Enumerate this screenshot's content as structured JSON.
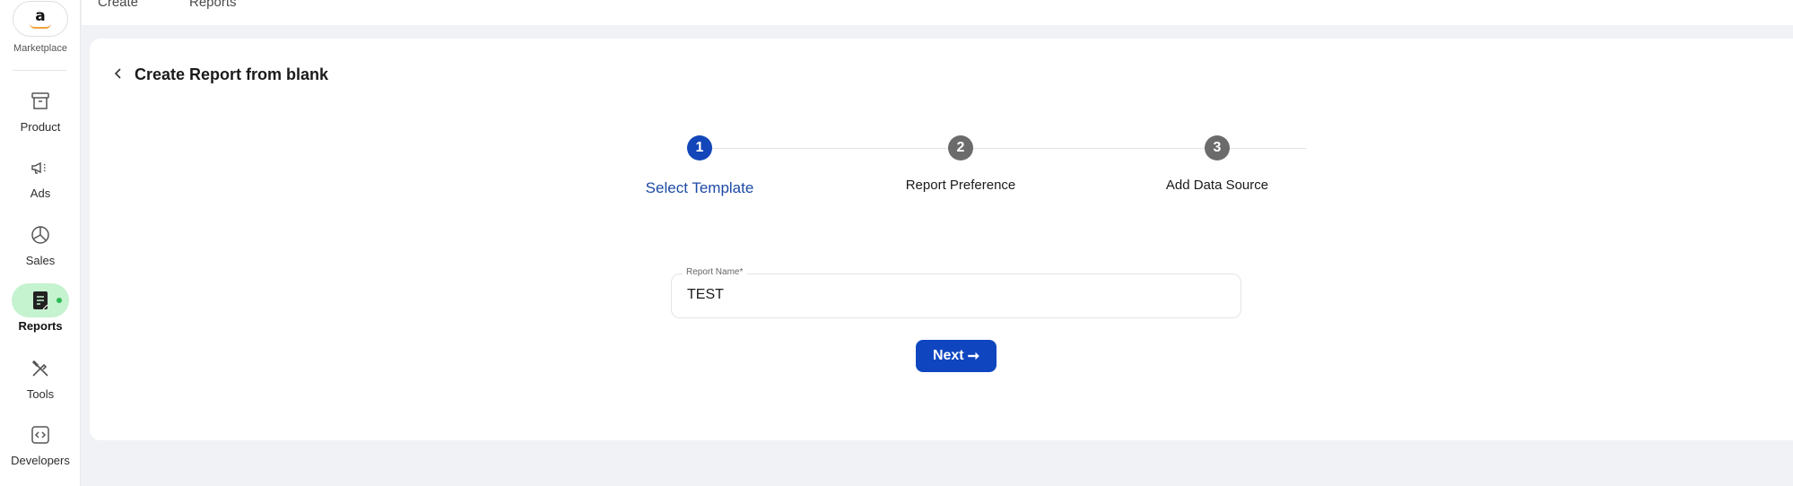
{
  "sidebar": {
    "logo_letter": "a",
    "logo_label": "Marketplace",
    "items": [
      {
        "label": "Product",
        "icon": "archive-box-icon",
        "active": false
      },
      {
        "label": "Ads",
        "icon": "megaphone-icon",
        "active": false
      },
      {
        "label": "Sales",
        "icon": "pie-chart-icon",
        "active": false
      },
      {
        "label": "Reports",
        "icon": "report-document-icon",
        "active": true
      },
      {
        "label": "Tools",
        "icon": "tools-icon",
        "active": false
      },
      {
        "label": "Developers",
        "icon": "code-icon",
        "active": false
      }
    ]
  },
  "topbar": {
    "tabs": [
      {
        "label": "Create"
      },
      {
        "label": "Reports"
      }
    ]
  },
  "page": {
    "title": "Create Report from blank"
  },
  "stepper": {
    "steps": [
      {
        "number": "1",
        "label": "Select Template",
        "state": "active"
      },
      {
        "number": "2",
        "label": "Report Preference",
        "state": "pending"
      },
      {
        "number": "3",
        "label": "Add Data Source",
        "state": "pending"
      }
    ]
  },
  "form": {
    "report_name_label": "Report Name*",
    "report_name_value": "TEST",
    "next_label": "Next",
    "next_arrow": "➞"
  },
  "colors": {
    "primary": "#0f46c0",
    "active_nav_bg": "#c5f2cf",
    "active_dot": "#2bbb56",
    "page_bg": "#f1f2f6"
  }
}
